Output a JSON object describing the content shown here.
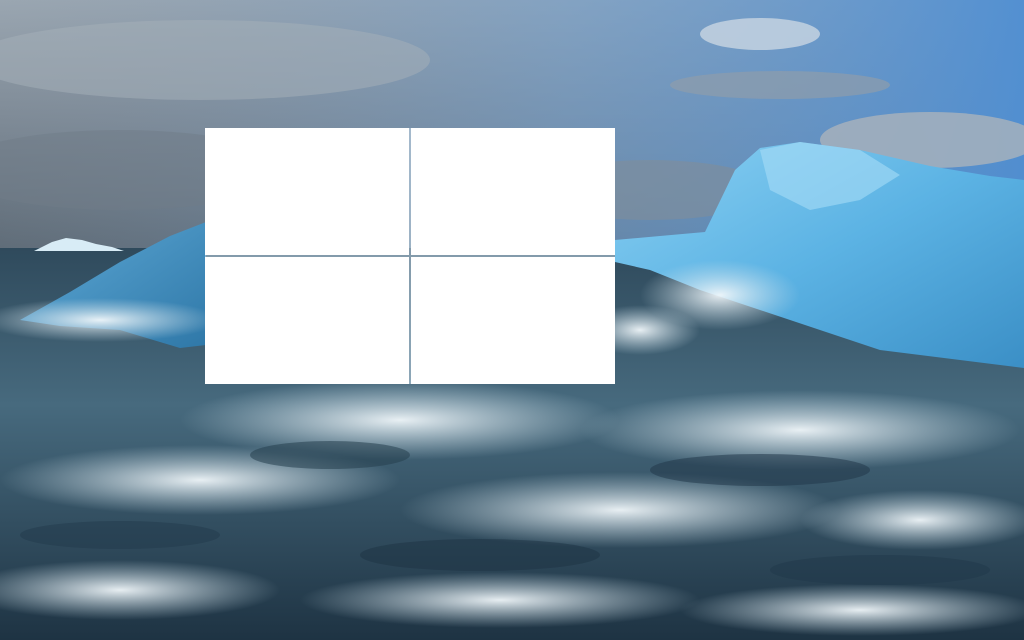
{
  "screen": {
    "name": "desktop",
    "wallpaper_subject": "icebergs-and-ocean-waves"
  },
  "colors": {
    "sky_top": "#6a9fd6",
    "cloud_gray": "#8d99a6",
    "iceberg_blue": "#5fb4e3",
    "sea_dark": "#2a4556",
    "foam": "#dfe9ee",
    "logo_white": "#ffffff"
  },
  "logo": {
    "icon": "windows-logo-icon",
    "panes": [
      "top-left",
      "top-right",
      "bottom-left",
      "bottom-right"
    ]
  }
}
